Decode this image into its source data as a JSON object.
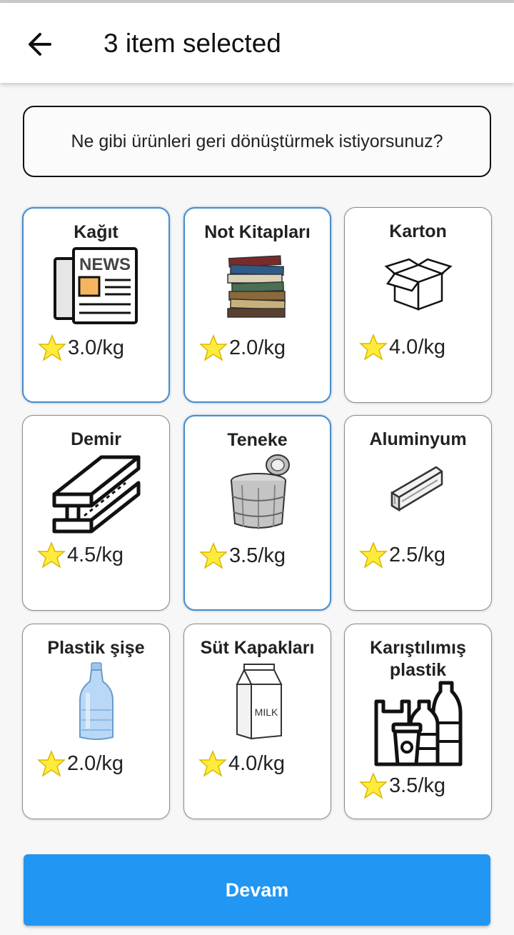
{
  "header": {
    "title": "3 item selected"
  },
  "question": "Ne gibi ürünleri geri dönüştürmek istiyorsunuz?",
  "items": [
    {
      "name": "Kağıt",
      "price": "3.0/kg",
      "icon": "newspaper-icon",
      "selected": true
    },
    {
      "name": "Not Kitapları",
      "price": "2.0/kg",
      "icon": "books-icon",
      "selected": true
    },
    {
      "name": "Karton",
      "price": "4.0/kg",
      "icon": "box-icon",
      "selected": false
    },
    {
      "name": "Demir",
      "price": "4.5/kg",
      "icon": "steel-beam-icon",
      "selected": false
    },
    {
      "name": "Teneke",
      "price": "3.5/kg",
      "icon": "tin-can-icon",
      "selected": true
    },
    {
      "name": "Aluminyum",
      "price": "2.5/kg",
      "icon": "aluminum-profile-icon",
      "selected": false
    },
    {
      "name": "Plastik şişe",
      "price": "2.0/kg",
      "icon": "plastic-bottle-icon",
      "selected": false
    },
    {
      "name": "Süt Kapakları",
      "price": "4.0/kg",
      "icon": "milk-carton-icon",
      "selected": false
    },
    {
      "name": "Karıştılımış plastik",
      "price": "3.5/kg",
      "icon": "mixed-plastic-icon",
      "selected": false
    }
  ],
  "continue_button": "Devam",
  "colors": {
    "accent": "#2196f3",
    "selected_border": "#4a8cc9",
    "star": "#ffeb3b"
  }
}
